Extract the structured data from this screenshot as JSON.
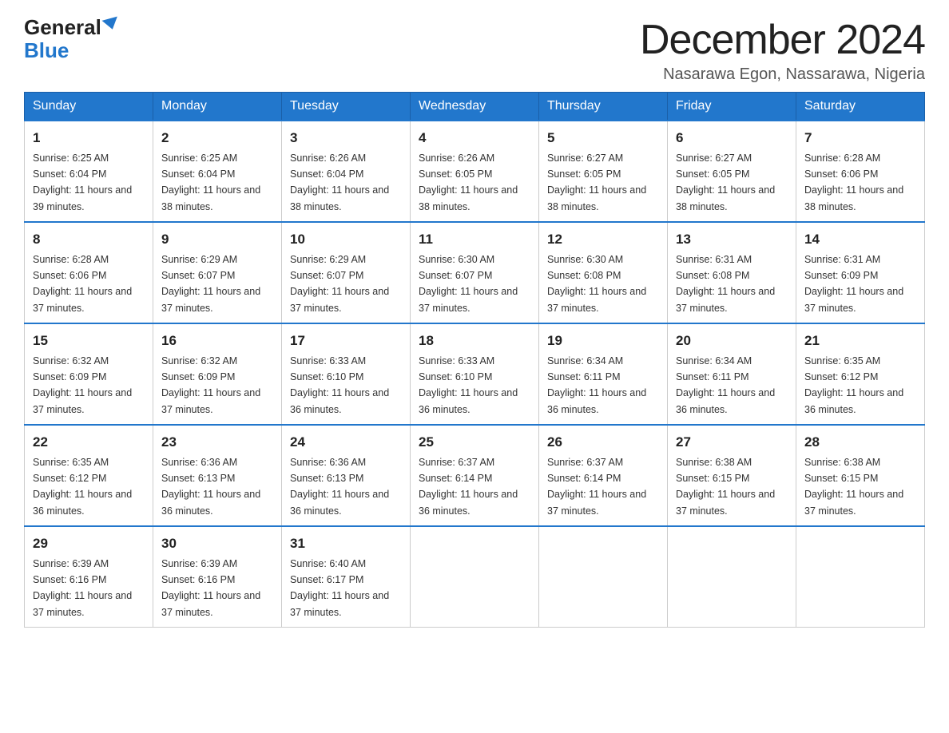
{
  "logo": {
    "general": "General",
    "blue": "Blue",
    "triangle": "▲"
  },
  "title": "December 2024",
  "subtitle": "Nasarawa Egon, Nassarawa, Nigeria",
  "weekdays": [
    "Sunday",
    "Monday",
    "Tuesday",
    "Wednesday",
    "Thursday",
    "Friday",
    "Saturday"
  ],
  "weeks": [
    [
      {
        "day": "1",
        "sunrise": "6:25 AM",
        "sunset": "6:04 PM",
        "daylight": "11 hours and 39 minutes."
      },
      {
        "day": "2",
        "sunrise": "6:25 AM",
        "sunset": "6:04 PM",
        "daylight": "11 hours and 38 minutes."
      },
      {
        "day": "3",
        "sunrise": "6:26 AM",
        "sunset": "6:04 PM",
        "daylight": "11 hours and 38 minutes."
      },
      {
        "day": "4",
        "sunrise": "6:26 AM",
        "sunset": "6:05 PM",
        "daylight": "11 hours and 38 minutes."
      },
      {
        "day": "5",
        "sunrise": "6:27 AM",
        "sunset": "6:05 PM",
        "daylight": "11 hours and 38 minutes."
      },
      {
        "day": "6",
        "sunrise": "6:27 AM",
        "sunset": "6:05 PM",
        "daylight": "11 hours and 38 minutes."
      },
      {
        "day": "7",
        "sunrise": "6:28 AM",
        "sunset": "6:06 PM",
        "daylight": "11 hours and 38 minutes."
      }
    ],
    [
      {
        "day": "8",
        "sunrise": "6:28 AM",
        "sunset": "6:06 PM",
        "daylight": "11 hours and 37 minutes."
      },
      {
        "day": "9",
        "sunrise": "6:29 AM",
        "sunset": "6:07 PM",
        "daylight": "11 hours and 37 minutes."
      },
      {
        "day": "10",
        "sunrise": "6:29 AM",
        "sunset": "6:07 PM",
        "daylight": "11 hours and 37 minutes."
      },
      {
        "day": "11",
        "sunrise": "6:30 AM",
        "sunset": "6:07 PM",
        "daylight": "11 hours and 37 minutes."
      },
      {
        "day": "12",
        "sunrise": "6:30 AM",
        "sunset": "6:08 PM",
        "daylight": "11 hours and 37 minutes."
      },
      {
        "day": "13",
        "sunrise": "6:31 AM",
        "sunset": "6:08 PM",
        "daylight": "11 hours and 37 minutes."
      },
      {
        "day": "14",
        "sunrise": "6:31 AM",
        "sunset": "6:09 PM",
        "daylight": "11 hours and 37 minutes."
      }
    ],
    [
      {
        "day": "15",
        "sunrise": "6:32 AM",
        "sunset": "6:09 PM",
        "daylight": "11 hours and 37 minutes."
      },
      {
        "day": "16",
        "sunrise": "6:32 AM",
        "sunset": "6:09 PM",
        "daylight": "11 hours and 37 minutes."
      },
      {
        "day": "17",
        "sunrise": "6:33 AM",
        "sunset": "6:10 PM",
        "daylight": "11 hours and 36 minutes."
      },
      {
        "day": "18",
        "sunrise": "6:33 AM",
        "sunset": "6:10 PM",
        "daylight": "11 hours and 36 minutes."
      },
      {
        "day": "19",
        "sunrise": "6:34 AM",
        "sunset": "6:11 PM",
        "daylight": "11 hours and 36 minutes."
      },
      {
        "day": "20",
        "sunrise": "6:34 AM",
        "sunset": "6:11 PM",
        "daylight": "11 hours and 36 minutes."
      },
      {
        "day": "21",
        "sunrise": "6:35 AM",
        "sunset": "6:12 PM",
        "daylight": "11 hours and 36 minutes."
      }
    ],
    [
      {
        "day": "22",
        "sunrise": "6:35 AM",
        "sunset": "6:12 PM",
        "daylight": "11 hours and 36 minutes."
      },
      {
        "day": "23",
        "sunrise": "6:36 AM",
        "sunset": "6:13 PM",
        "daylight": "11 hours and 36 minutes."
      },
      {
        "day": "24",
        "sunrise": "6:36 AM",
        "sunset": "6:13 PM",
        "daylight": "11 hours and 36 minutes."
      },
      {
        "day": "25",
        "sunrise": "6:37 AM",
        "sunset": "6:14 PM",
        "daylight": "11 hours and 36 minutes."
      },
      {
        "day": "26",
        "sunrise": "6:37 AM",
        "sunset": "6:14 PM",
        "daylight": "11 hours and 37 minutes."
      },
      {
        "day": "27",
        "sunrise": "6:38 AM",
        "sunset": "6:15 PM",
        "daylight": "11 hours and 37 minutes."
      },
      {
        "day": "28",
        "sunrise": "6:38 AM",
        "sunset": "6:15 PM",
        "daylight": "11 hours and 37 minutes."
      }
    ],
    [
      {
        "day": "29",
        "sunrise": "6:39 AM",
        "sunset": "6:16 PM",
        "daylight": "11 hours and 37 minutes."
      },
      {
        "day": "30",
        "sunrise": "6:39 AM",
        "sunset": "6:16 PM",
        "daylight": "11 hours and 37 minutes."
      },
      {
        "day": "31",
        "sunrise": "6:40 AM",
        "sunset": "6:17 PM",
        "daylight": "11 hours and 37 minutes."
      },
      null,
      null,
      null,
      null
    ]
  ]
}
